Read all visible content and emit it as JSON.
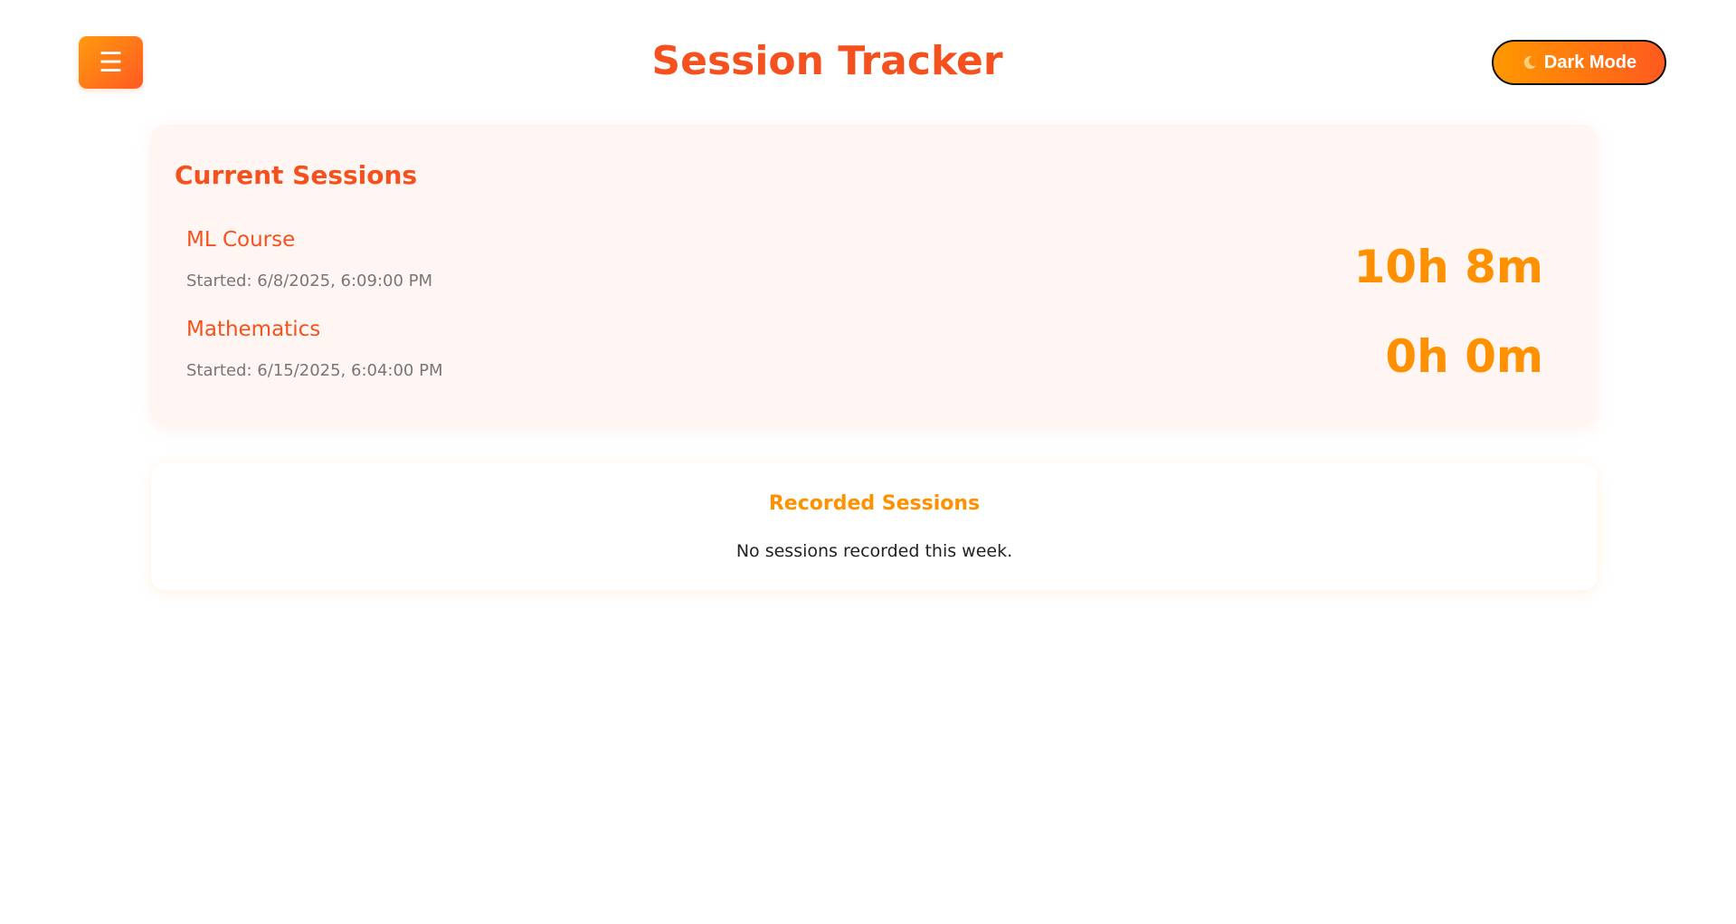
{
  "header": {
    "menu_icon": "menu-icon",
    "menu_glyph": "☰",
    "title": "Session Tracker",
    "dark_mode_label": "Dark Mode",
    "dark_mode_icon": "moon-icon"
  },
  "current_sessions": {
    "title": "Current Sessions",
    "items": [
      {
        "name": "ML Course",
        "started": "Started: 6/8/2025, 6:09:00 PM",
        "duration": "10h 8m"
      },
      {
        "name": "Mathematics",
        "started": "Started: 6/15/2025, 6:04:00 PM",
        "duration": "0h 0m"
      }
    ]
  },
  "recorded_sessions": {
    "title": "Recorded Sessions",
    "empty_message": "No sessions recorded this week."
  },
  "colors": {
    "accent": "#f4511e",
    "accent_orange": "#ff9100",
    "card_background": "#fff6f3",
    "muted_text": "#777777"
  }
}
